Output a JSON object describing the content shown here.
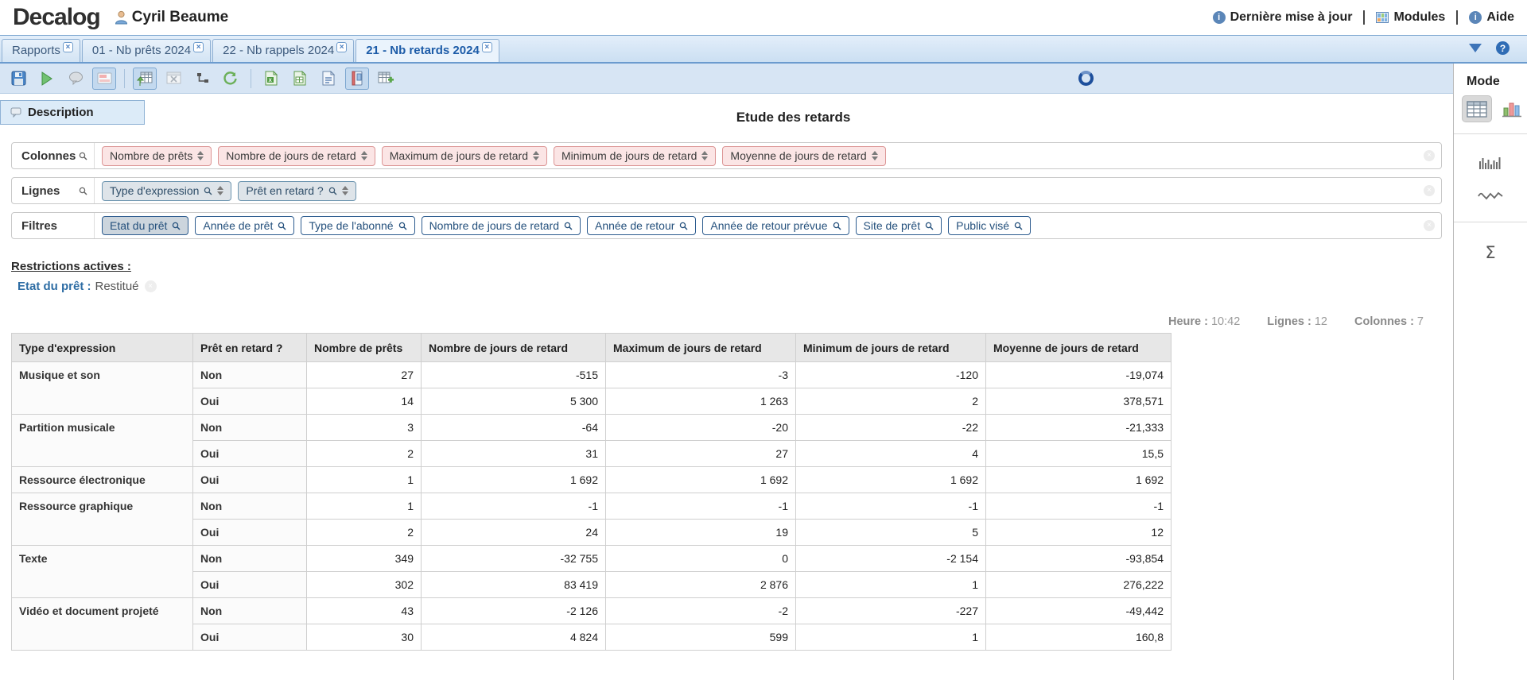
{
  "header": {
    "logo": "Decalog",
    "user": "Cyril Beaume",
    "links": [
      {
        "label": "Dernière mise à jour",
        "icon": "info-icon"
      },
      {
        "label": "Modules",
        "icon": "modules-icon"
      },
      {
        "label": "Aide",
        "icon": "info-icon"
      }
    ]
  },
  "tabs": [
    {
      "label": "Rapports",
      "active": false
    },
    {
      "label": "01 - Nb prêts 2024",
      "active": false
    },
    {
      "label": "22 - Nb rappels 2024",
      "active": false
    },
    {
      "label": "21 - Nb retards 2024",
      "active": true
    }
  ],
  "toolbar": {
    "buttons": [
      {
        "name": "save-icon",
        "active": false
      },
      {
        "name": "run-icon",
        "active": false
      },
      {
        "name": "comment-icon",
        "active": false
      },
      {
        "name": "layout-panel-icon",
        "active": true
      },
      {
        "name": "divider"
      },
      {
        "name": "table-load-icon",
        "active": true
      },
      {
        "name": "table-clear-icon",
        "active": false
      },
      {
        "name": "dependencies-icon",
        "active": false
      },
      {
        "name": "refresh-icon",
        "active": false
      },
      {
        "name": "divider"
      },
      {
        "name": "export-excel-icon",
        "active": false
      },
      {
        "name": "export-sheet-icon",
        "active": false
      },
      {
        "name": "export-doc-icon",
        "active": false
      },
      {
        "name": "report-book-icon",
        "active": true
      },
      {
        "name": "table-add-icon",
        "active": false
      }
    ]
  },
  "view": {
    "description_tab": "Description",
    "title": "Etude des retards"
  },
  "pivot": {
    "colonnes_label": "Colonnes",
    "colonnes": [
      "Nombre de prêts",
      "Nombre de jours de retard",
      "Maximum de jours de retard",
      "Minimum de jours de retard",
      "Moyenne de jours de retard"
    ],
    "lignes_label": "Lignes",
    "lignes": [
      "Type d'expression",
      "Prêt en retard ?"
    ],
    "filtres_label": "Filtres",
    "filtres": [
      {
        "label": "Etat du prêt",
        "selected": true
      },
      {
        "label": "Année de prêt",
        "selected": false
      },
      {
        "label": "Type de l'abonné",
        "selected": false
      },
      {
        "label": "Nombre de jours de retard",
        "selected": false
      },
      {
        "label": "Année de retour",
        "selected": false
      },
      {
        "label": "Année de retour prévue",
        "selected": false
      },
      {
        "label": "Site de prêt",
        "selected": false
      },
      {
        "label": "Public visé",
        "selected": false
      }
    ]
  },
  "restrictions": {
    "title": "Restrictions actives :",
    "items": [
      {
        "field": "Etat du prêt :",
        "value": "Restitué"
      }
    ]
  },
  "stats": [
    {
      "label": "Heure :",
      "value": "10:42"
    },
    {
      "label": "Lignes :",
      "value": "12"
    },
    {
      "label": "Colonnes :",
      "value": "7"
    }
  ],
  "table": {
    "headers": [
      "Type d'expression",
      "Prêt en retard ?",
      "Nombre de prêts",
      "Nombre de jours de retard",
      "Maximum de jours de retard",
      "Minimum de jours de retard",
      "Moyenne de jours de retard"
    ],
    "groups": [
      {
        "type": "Musique et son",
        "rows": [
          {
            "retard": "Non",
            "values": [
              "27",
              "-515",
              "-3",
              "-120",
              "-19,074"
            ]
          },
          {
            "retard": "Oui",
            "values": [
              "14",
              "5 300",
              "1 263",
              "2",
              "378,571"
            ]
          }
        ]
      },
      {
        "type": "Partition musicale",
        "rows": [
          {
            "retard": "Non",
            "values": [
              "3",
              "-64",
              "-20",
              "-22",
              "-21,333"
            ]
          },
          {
            "retard": "Oui",
            "values": [
              "2",
              "31",
              "27",
              "4",
              "15,5"
            ]
          }
        ]
      },
      {
        "type": "Ressource électronique",
        "rows": [
          {
            "retard": "Oui",
            "values": [
              "1",
              "1 692",
              "1 692",
              "1 692",
              "1 692"
            ]
          }
        ]
      },
      {
        "type": "Ressource graphique",
        "rows": [
          {
            "retard": "Non",
            "values": [
              "1",
              "-1",
              "-1",
              "-1",
              "-1"
            ]
          },
          {
            "retard": "Oui",
            "values": [
              "2",
              "24",
              "19",
              "5",
              "12"
            ]
          }
        ]
      },
      {
        "type": "Texte",
        "rows": [
          {
            "retard": "Non",
            "values": [
              "349",
              "-32 755",
              "0",
              "-2 154",
              "-93,854"
            ]
          },
          {
            "retard": "Oui",
            "values": [
              "302",
              "83 419",
              "2 876",
              "1",
              "276,222"
            ]
          }
        ]
      },
      {
        "type": "Vidéo et document projeté",
        "rows": [
          {
            "retard": "Non",
            "values": [
              "43",
              "-2 126",
              "-2",
              "-227",
              "-49,442"
            ]
          },
          {
            "retard": "Oui",
            "values": [
              "30",
              "4 824",
              "599",
              "1",
              "160,8"
            ]
          }
        ]
      }
    ]
  },
  "sidebar": {
    "mode_label": "Mode",
    "sigma_glyph": "Σ",
    "colors": {
      "accent_blue": "#1d5ca8",
      "chip_pink_border": "#dc9696",
      "filter_border": "#2d5c8f"
    }
  }
}
